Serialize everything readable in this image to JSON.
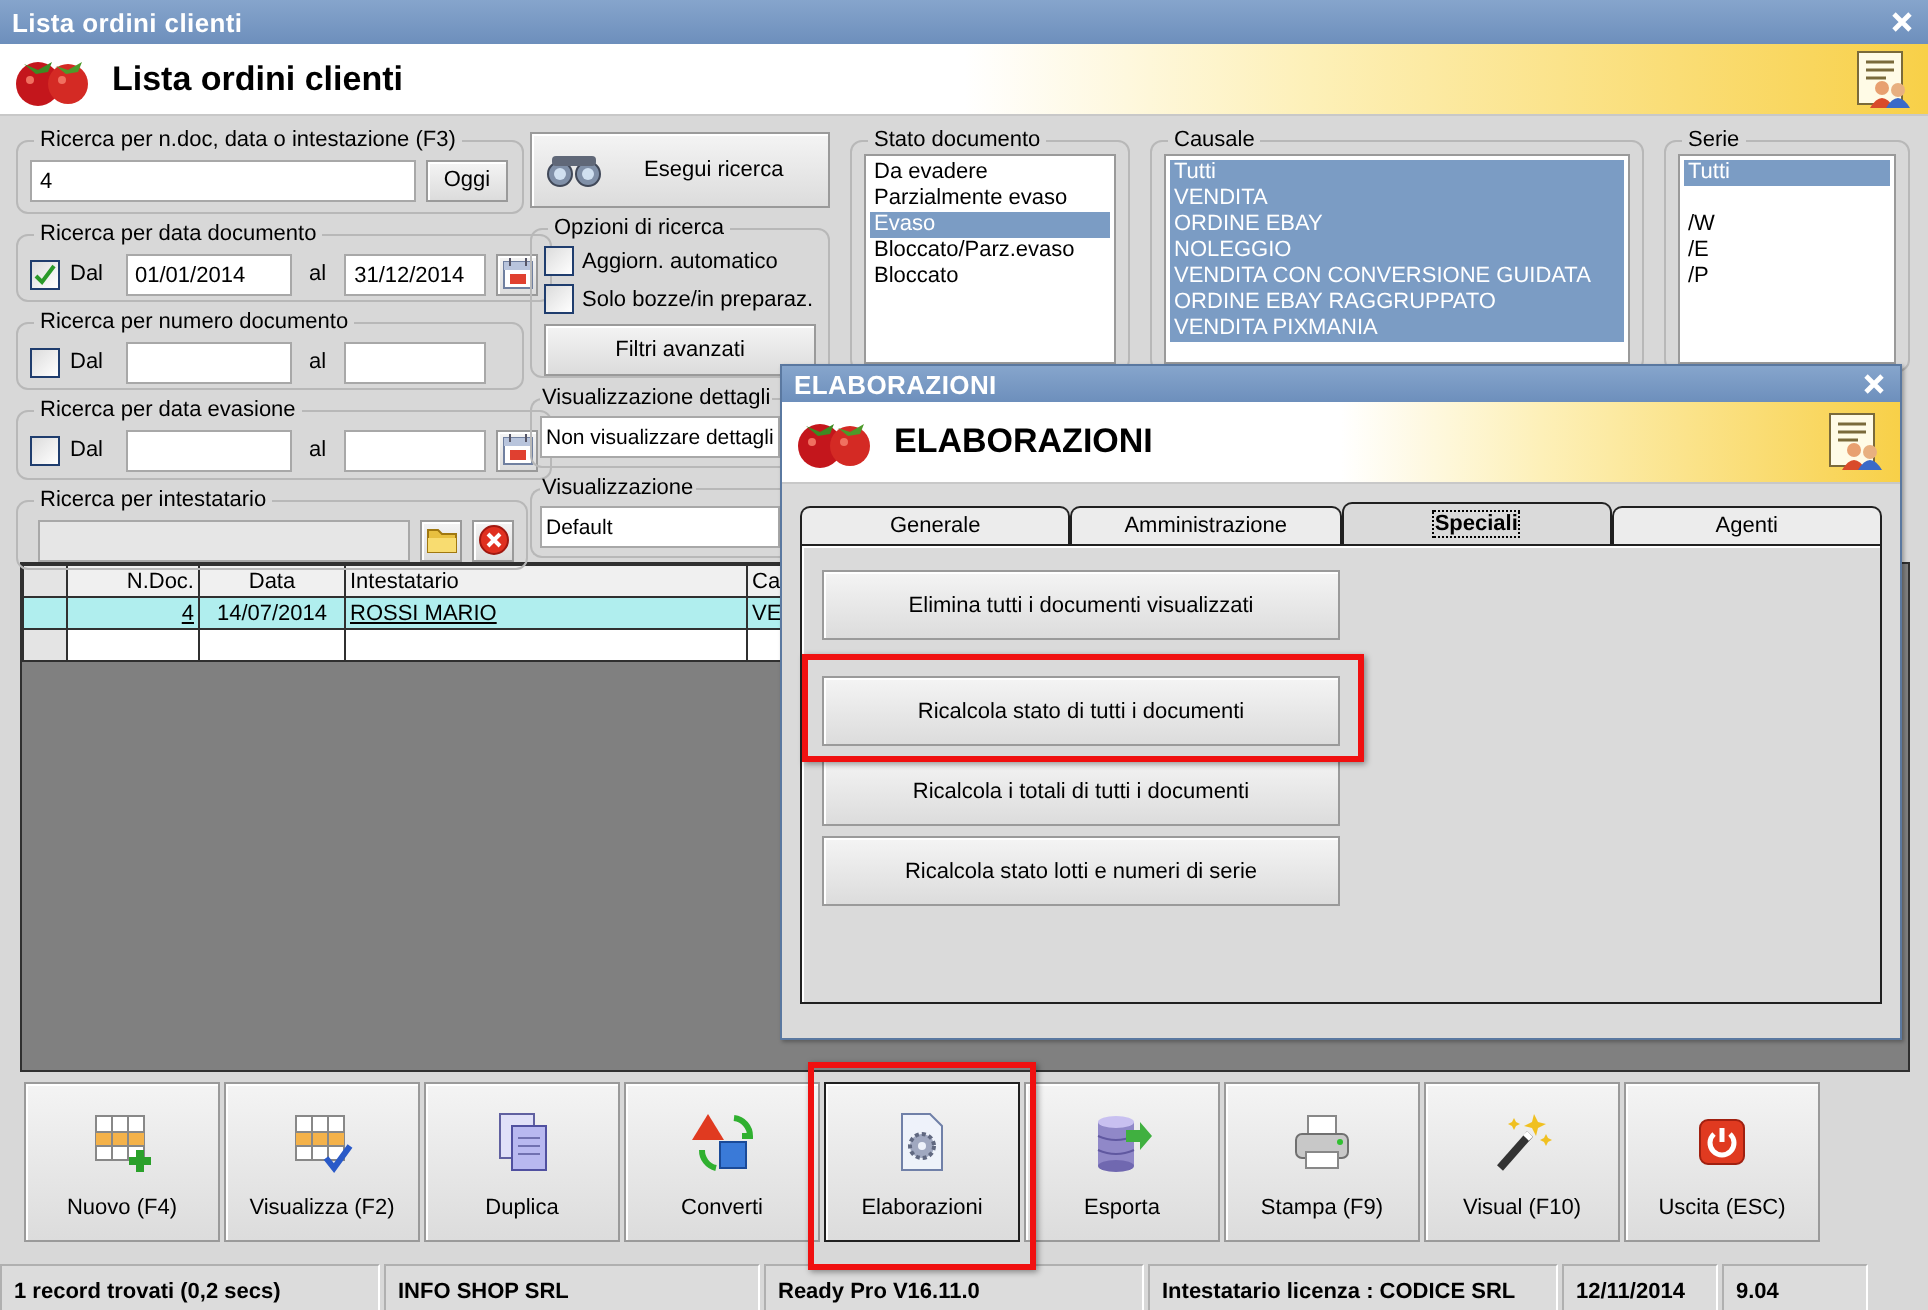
{
  "window": {
    "title": "Lista ordini clienti"
  },
  "header": {
    "title": "Lista ordini clienti"
  },
  "quick_search": {
    "label": "Ricerca per n.doc, data o intestazione (F3)",
    "value": "4",
    "button": "Oggi"
  },
  "date_searches": [
    {
      "label": "Ricerca per data documento",
      "checkbox": "Dal",
      "checked": true,
      "from": "01/01/2014",
      "to_label": "al",
      "to": "31/12/2014",
      "calendar": true
    },
    {
      "label": "Ricerca per numero documento",
      "checkbox": "Dal",
      "checked": false,
      "to_label": "al",
      "calendar": false
    },
    {
      "label": "Ricerca per data evasione",
      "checkbox": "Dal",
      "checked": false,
      "to_label": "al",
      "calendar": true
    }
  ],
  "holder_search": {
    "label": "Ricerca per intestatario",
    "disabled": true
  },
  "run_search": {
    "label": "Esegui ricerca"
  },
  "search_options": {
    "label": "Opzioni di ricerca",
    "items": [
      {
        "label": "Aggiorn. automatico",
        "checked": false
      },
      {
        "label": "Solo bozze/in preparaz.",
        "checked": false
      }
    ],
    "button": "Filtri avanzati"
  },
  "details_view": {
    "label": "Visualizzazione dettagli",
    "value": "Non visualizzare dettagli"
  },
  "view": {
    "label": "Visualizzazione",
    "value": "Default"
  },
  "lists": [
    {
      "title": "Stato documento",
      "items": [
        {
          "kind": "text",
          "label": "Da evadere",
          "selected": false
        },
        {
          "kind": "text",
          "label": "Parzialmente evaso",
          "selected": false
        },
        {
          "kind": "text",
          "label": "Evaso",
          "selected": true
        },
        {
          "kind": "text",
          "label": "Bloccato/Parz.evaso",
          "selected": false
        },
        {
          "kind": "text",
          "label": "Bloccato",
          "selected": false
        }
      ]
    },
    {
      "title": "Causale",
      "items": [
        {
          "kind": "text",
          "label": "Tutti",
          "selected": true
        },
        {
          "kind": "text",
          "label": "VENDITA",
          "selected": true
        },
        {
          "kind": "text",
          "label": "ORDINE EBAY",
          "selected": true
        },
        {
          "kind": "text",
          "label": "NOLEGGIO",
          "selected": true
        },
        {
          "kind": "text",
          "label": "VENDITA CON CONVERSIONE GUIDATA",
          "selected": true
        },
        {
          "kind": "text",
          "label": "ORDINE EBAY RAGGRUPPATO",
          "selected": true
        },
        {
          "kind": "text",
          "label": "VENDITA PIXMANIA",
          "selected": true
        }
      ]
    },
    {
      "title": "Serie",
      "items": [
        {
          "kind": "text",
          "label": "Tutti",
          "selected": true
        },
        {
          "kind": "empty"
        },
        {
          "kind": "text",
          "label": "/W",
          "selected": false
        },
        {
          "kind": "text",
          "label": "/E",
          "selected": false
        },
        {
          "kind": "text",
          "label": "/P",
          "selected": false
        }
      ]
    }
  ],
  "grid": {
    "columns": [
      {
        "label": "N.Doc.",
        "link": true
      },
      {
        "label": "Data",
        "link": false
      },
      {
        "label": "Intestatario",
        "link": true
      },
      {
        "label": "Ca",
        "link": false
      }
    ],
    "rows": [
      {
        "cells": [
          "4",
          "14/07/2014",
          "ROSSI MARIO",
          "VE"
        ],
        "selected": true
      }
    ]
  },
  "toolbar": [
    {
      "label": "Nuovo (F4)",
      "focused": false,
      "highlighted": false
    },
    {
      "label": "Visualizza (F2)",
      "focused": false,
      "highlighted": false
    },
    {
      "label": "Duplica",
      "focused": false,
      "highlighted": false
    },
    {
      "label": "Converti",
      "focused": false,
      "highlighted": false
    },
    {
      "label": "Elaborazioni",
      "focused": true,
      "highlighted": true
    },
    {
      "label": "Esporta",
      "focused": false,
      "highlighted": false
    },
    {
      "label": "Stampa (F9)",
      "focused": false,
      "highlighted": false
    },
    {
      "label": "Visual (F10)",
      "focused": false,
      "highlighted": false
    },
    {
      "label": "Uscita (ESC)",
      "focused": false,
      "highlighted": false
    }
  ],
  "status_bar": [
    "1 record trovati (0,2 secs)",
    "INFO SHOP SRL",
    "Ready Pro V16.11.0",
    "Intestatario licenza : CODICE SRL",
    "12/11/2014",
    "9.04"
  ],
  "dialog": {
    "title": "ELABORAZIONI",
    "header": "ELABORAZIONI",
    "tabs": [
      {
        "label": "Generale",
        "selected": false
      },
      {
        "label": "Amministrazione",
        "selected": false
      },
      {
        "label": "Speciali",
        "selected": true
      },
      {
        "label": "Agenti",
        "selected": false
      }
    ],
    "buttons": [
      {
        "label": "Elimina tutti i documenti visualizzati",
        "highlighted": false
      },
      {
        "label": "Ricalcola stato di tutti i documenti",
        "highlighted": true
      },
      {
        "label": "Ricalcola i totali di tutti i documenti",
        "highlighted": false
      },
      {
        "label": "Ricalcola stato lotti e numeri di serie",
        "highlighted": false
      }
    ]
  }
}
